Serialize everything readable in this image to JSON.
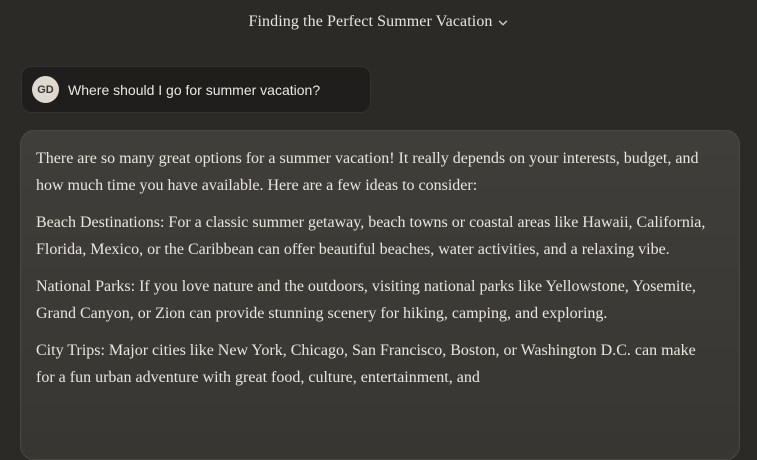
{
  "header": {
    "title": "Finding the Perfect Summer Vacation"
  },
  "user_message": {
    "avatar_initials": "GD",
    "text": "Where should I go for summer vacation?"
  },
  "assistant_message": {
    "paragraphs": [
      "There are so many great options for a summer vacation! It really depends on your interests, budget, and how much time you have available. Here are a few ideas to consider:",
      "Beach Destinations: For a classic summer getaway, beach towns or coastal areas like Hawaii, California, Florida, Mexico, or the Caribbean can offer beautiful beaches, water activities, and a relaxing vibe.",
      "National Parks: If you love nature and the outdoors, visiting national parks like Yellowstone, Yosemite, Grand Canyon, or Zion can provide stunning scenery for hiking, camping, and exploring.",
      "City Trips: Major cities like New York, Chicago, San Francisco, Boston, or Washington D.C. can make for a fun urban adventure with great food, culture, entertainment, and"
    ]
  },
  "colors": {
    "background": "#2b2a27",
    "user_bubble": "#1f1e1c",
    "assistant_bubble": "#3c3a36",
    "text": "#e8e5dd",
    "avatar": "#ddd9cf"
  }
}
